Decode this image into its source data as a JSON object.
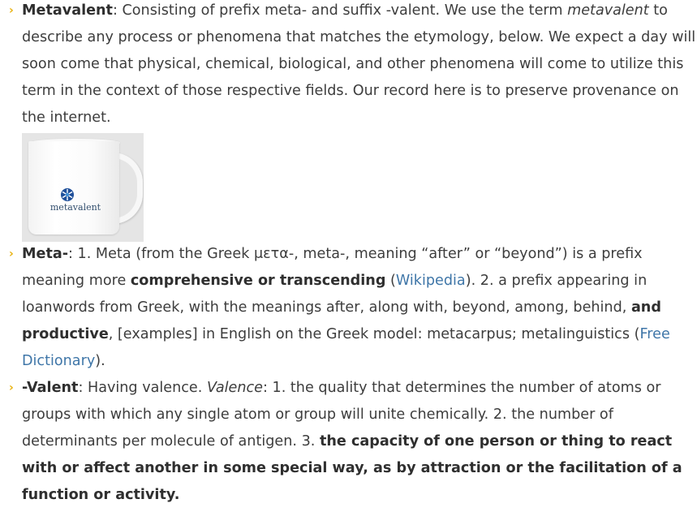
{
  "items": [
    {
      "term": "Metavalent",
      "text_1": ": Consisting of prefix meta- and suffix -valent. We use the term ",
      "em_1": "metavalent",
      "text_2": " to describe any process or phenomena that matches the etymology, below. We expect a day will soon come that physical, chemical, biological, and other phenomena will come to utilize this term in the context of those respective fields. Our record here is to preserve provenance on the internet.",
      "image": {
        "label": "metavalent",
        "icon": "metavalent-logo-icon"
      }
    },
    {
      "term": "Meta-",
      "text_1": ": 1. Meta (from the Greek μετα-, meta-, meaning “after” or “beyond”) is a prefix meaning more ",
      "bold_1": "comprehensive or transcending",
      "text_2": " (",
      "link_1": "Wikipedia",
      "text_3": "). 2. a prefix appearing in loanwords from Greek, with the meanings after, along with, beyond, among, behind, ",
      "bold_2": "and productive",
      "text_4": ", [examples] in English on the Greek model: metacarpus; metalinguistics (",
      "link_2": "Free Dictionary",
      "text_5": ")."
    },
    {
      "term": "-Valent",
      "text_1": ": Having valence. ",
      "em_1": "Valence",
      "text_2": ": 1. the quality that determines the number of atoms or groups with which any single atom or group will unite chemically. 2. the number of determinants per molecule of antigen. 3. ",
      "bold_1": "the capacity of one person or thing to react with or affect another in some special way, as by attraction or the facilitation of a function or activity."
    }
  ],
  "bullet_glyph": "›",
  "colors": {
    "bullet": "#e8b10e",
    "link": "#3f76a8",
    "text": "#3d3d3d"
  }
}
